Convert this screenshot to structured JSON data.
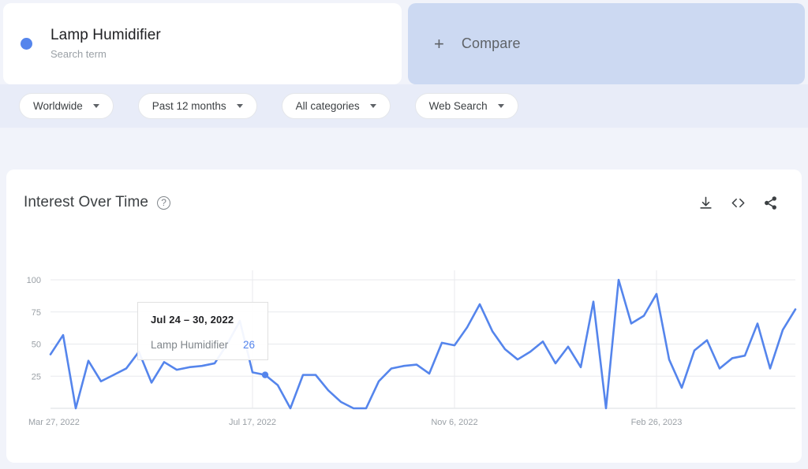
{
  "term": {
    "title": "Lamp Humidifier",
    "subtitle": "Search term",
    "dot_color": "#5585ec"
  },
  "compare": {
    "label": "Compare",
    "plus": "+"
  },
  "filters": [
    {
      "label": "Worldwide"
    },
    {
      "label": "Past 12 months"
    },
    {
      "label": "All categories"
    },
    {
      "label": "Web Search"
    }
  ],
  "chart_header": {
    "title": "Interest Over Time",
    "help": "?",
    "icons": [
      "download-icon",
      "embed-icon",
      "share-icon"
    ]
  },
  "tooltip": {
    "date": "Jul 24 – 30, 2022",
    "series_name": "Lamp Humidifier",
    "value": "26"
  },
  "chart_data": {
    "type": "line",
    "title": "Interest Over Time",
    "xlabel": "",
    "ylabel": "",
    "ylim": [
      0,
      100
    ],
    "yticks": [
      25,
      50,
      75,
      100
    ],
    "ytick_labels": [
      "25",
      "50",
      "75",
      "100"
    ],
    "xtick_labels": [
      "Mar 27, 2022",
      "Jul 17, 2022",
      "Nov 6, 2022",
      "Feb 26, 2023"
    ],
    "xtick_indices": [
      0,
      16,
      32,
      48
    ],
    "grid": true,
    "legend_position": "none",
    "line_color": "#5585ec",
    "highlight_index": 17,
    "highlight_value": 26,
    "series": [
      {
        "name": "Lamp Humidifier",
        "values": [
          42,
          57,
          0,
          37,
          21,
          26,
          31,
          44,
          20,
          36,
          30,
          32,
          33,
          35,
          50,
          68,
          28,
          26,
          18,
          0,
          26,
          26,
          14,
          5,
          0,
          0,
          21,
          31,
          33,
          34,
          27,
          51,
          49,
          63,
          81,
          60,
          46,
          38,
          44,
          52,
          35,
          48,
          32,
          83,
          0,
          100,
          66,
          72,
          89,
          38,
          16,
          45,
          53,
          31,
          39,
          41,
          66,
          31,
          61,
          77
        ]
      }
    ]
  }
}
